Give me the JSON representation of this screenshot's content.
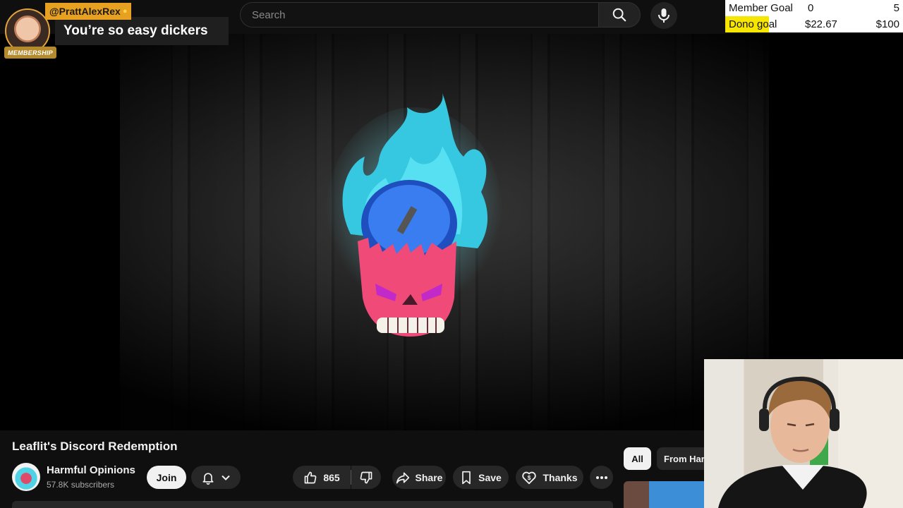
{
  "search": {
    "placeholder": "Search"
  },
  "alert": {
    "username": "@PrattAlexRex",
    "message": "You’re so easy dickers",
    "badge": "MEMBERSHIP"
  },
  "goals": {
    "member": {
      "label": "Member Goal",
      "current": "0",
      "target": "5"
    },
    "dono": {
      "label": "Dono goal",
      "current": "$22.67",
      "target": "$100"
    }
  },
  "video": {
    "title": "Leaflit's Discord Redemption"
  },
  "channel": {
    "name": "Harmful Opinions",
    "subscribers": "57.8K subscribers",
    "join_label": "Join"
  },
  "actions": {
    "likes": "865",
    "share_label": "Share",
    "save_label": "Save",
    "thanks_label": "Thanks"
  },
  "chips": [
    {
      "label": "All"
    },
    {
      "label": "From Har"
    }
  ],
  "colors": {
    "accent_alert": "#e8a020",
    "dono_fill": "#f7e600",
    "background": "#0f0f0f"
  }
}
